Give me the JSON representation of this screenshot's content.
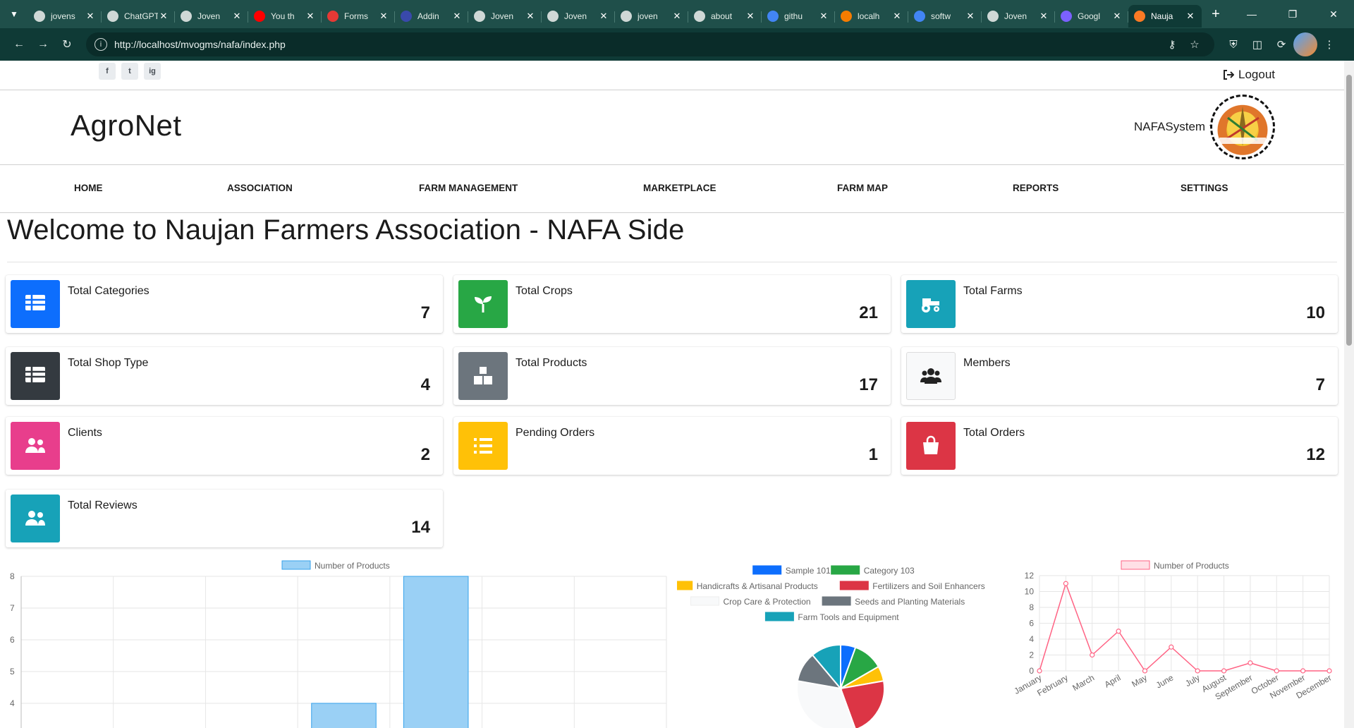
{
  "browser": {
    "tabs": [
      {
        "label": "jovens",
        "color": "#cfd8d6"
      },
      {
        "label": "ChatGPT",
        "color": "#cfd8d6"
      },
      {
        "label": "Joven",
        "color": "#cfd8d6"
      },
      {
        "label": "You th",
        "color": "#ff0000"
      },
      {
        "label": "Forms",
        "color": "#e53935"
      },
      {
        "label": "Addin",
        "color": "#3949ab"
      },
      {
        "label": "Joven",
        "color": "#cfd8d6"
      },
      {
        "label": "Joven",
        "color": "#cfd8d6"
      },
      {
        "label": "joven",
        "color": "#cfd8d6"
      },
      {
        "label": "about",
        "color": "#cfd8d6"
      },
      {
        "label": "githu",
        "color": "#4285f4"
      },
      {
        "label": "localh",
        "color": "#f57c00"
      },
      {
        "label": "softw",
        "color": "#4285f4"
      },
      {
        "label": "Joven",
        "color": "#cfd8d6"
      },
      {
        "label": "Googl",
        "color": "#7b61ff"
      },
      {
        "label": "Nauja",
        "color": "#fb7a24",
        "active": true
      }
    ],
    "url": "http://localhost/mvogms/nafa/index.php"
  },
  "header": {
    "logout_label": "Logout",
    "brand": "AgroNet",
    "account_name": "NAFASystem",
    "social": [
      "f",
      "t",
      "ig"
    ]
  },
  "nav": [
    {
      "label": "HOME"
    },
    {
      "label": "ASSOCIATION"
    },
    {
      "label": "FARM MANAGEMENT"
    },
    {
      "label": "MARKETPLACE"
    },
    {
      "label": "FARM MAP"
    },
    {
      "label": "REPORTS"
    },
    {
      "label": "SETTINGS"
    }
  ],
  "page": {
    "welcome": "Welcome to Naujan Farmers Association - NAFA Side"
  },
  "cards": [
    {
      "title": "Total Categories",
      "value": "7",
      "color": "#0d6efd",
      "icon": "table-icon"
    },
    {
      "title": "Total Crops",
      "value": "21",
      "color": "#28a745",
      "icon": "seedling-icon"
    },
    {
      "title": "Total Farms",
      "value": "10",
      "color": "#17a2b8",
      "icon": "tractor-icon"
    },
    {
      "title": "Total Shop Type",
      "value": "4",
      "color": "#343a40",
      "icon": "table-icon"
    },
    {
      "title": "Total Products",
      "value": "17",
      "color": "#6c757d",
      "icon": "boxes-icon"
    },
    {
      "title": "Members",
      "value": "7",
      "color": "#f8f9fa",
      "icon": "users-icon"
    },
    {
      "title": "Clients",
      "value": "2",
      "color": "#e83e8c",
      "icon": "user-friends-icon"
    },
    {
      "title": "Pending Orders",
      "value": "1",
      "color": "#ffc107",
      "icon": "list-icon"
    },
    {
      "title": "Total Orders",
      "value": "12",
      "color": "#dc3545",
      "icon": "shopping-bag-icon"
    },
    {
      "title": "Total Reviews",
      "value": "14",
      "color": "#17a2b8",
      "icon": "user-friends-icon"
    }
  ],
  "chart_data": [
    {
      "type": "bar",
      "series": [
        {
          "name": "Number of Products",
          "values": [
            null,
            null,
            null,
            4,
            8,
            null,
            null
          ]
        }
      ],
      "categories": [
        "",
        "",
        "",
        "",
        "",
        "",
        ""
      ],
      "ylim": [
        3.6,
        8
      ],
      "yticks": [
        4,
        5,
        6,
        7,
        8
      ],
      "grid": true,
      "legend": "top",
      "color": "#9ad0f5",
      "border": "#36a2eb"
    },
    {
      "type": "pie",
      "legend": "top",
      "labels": [
        "Sample 101",
        "Category 103",
        "Handicrafts & Artisanal Products",
        "Fertilizers and Soil Enhancers",
        "Crop Care & Protection",
        "Seeds and Planting Materials",
        "Farm Tools and Equipment"
      ],
      "values": [
        1,
        2,
        1,
        4,
        6,
        2,
        2
      ],
      "colors": [
        "#0d6efd",
        "#28a745",
        "#ffc107",
        "#dc3545",
        "#f8f9fa",
        "#6c757d",
        "#17a2b8"
      ]
    },
    {
      "type": "line",
      "series": [
        {
          "name": "Number of Products",
          "values": [
            0,
            11,
            2,
            5,
            0,
            3,
            0,
            0,
            1,
            0,
            0,
            0
          ]
        }
      ],
      "categories": [
        "January",
        "February",
        "March",
        "April",
        "May",
        "June",
        "July",
        "August",
        "September",
        "October",
        "November",
        "December"
      ],
      "ylim": [
        0,
        12
      ],
      "yticks": [
        0,
        2,
        4,
        6,
        8,
        10,
        12
      ],
      "grid": true,
      "legend": "top",
      "color": "#ff6384"
    }
  ]
}
